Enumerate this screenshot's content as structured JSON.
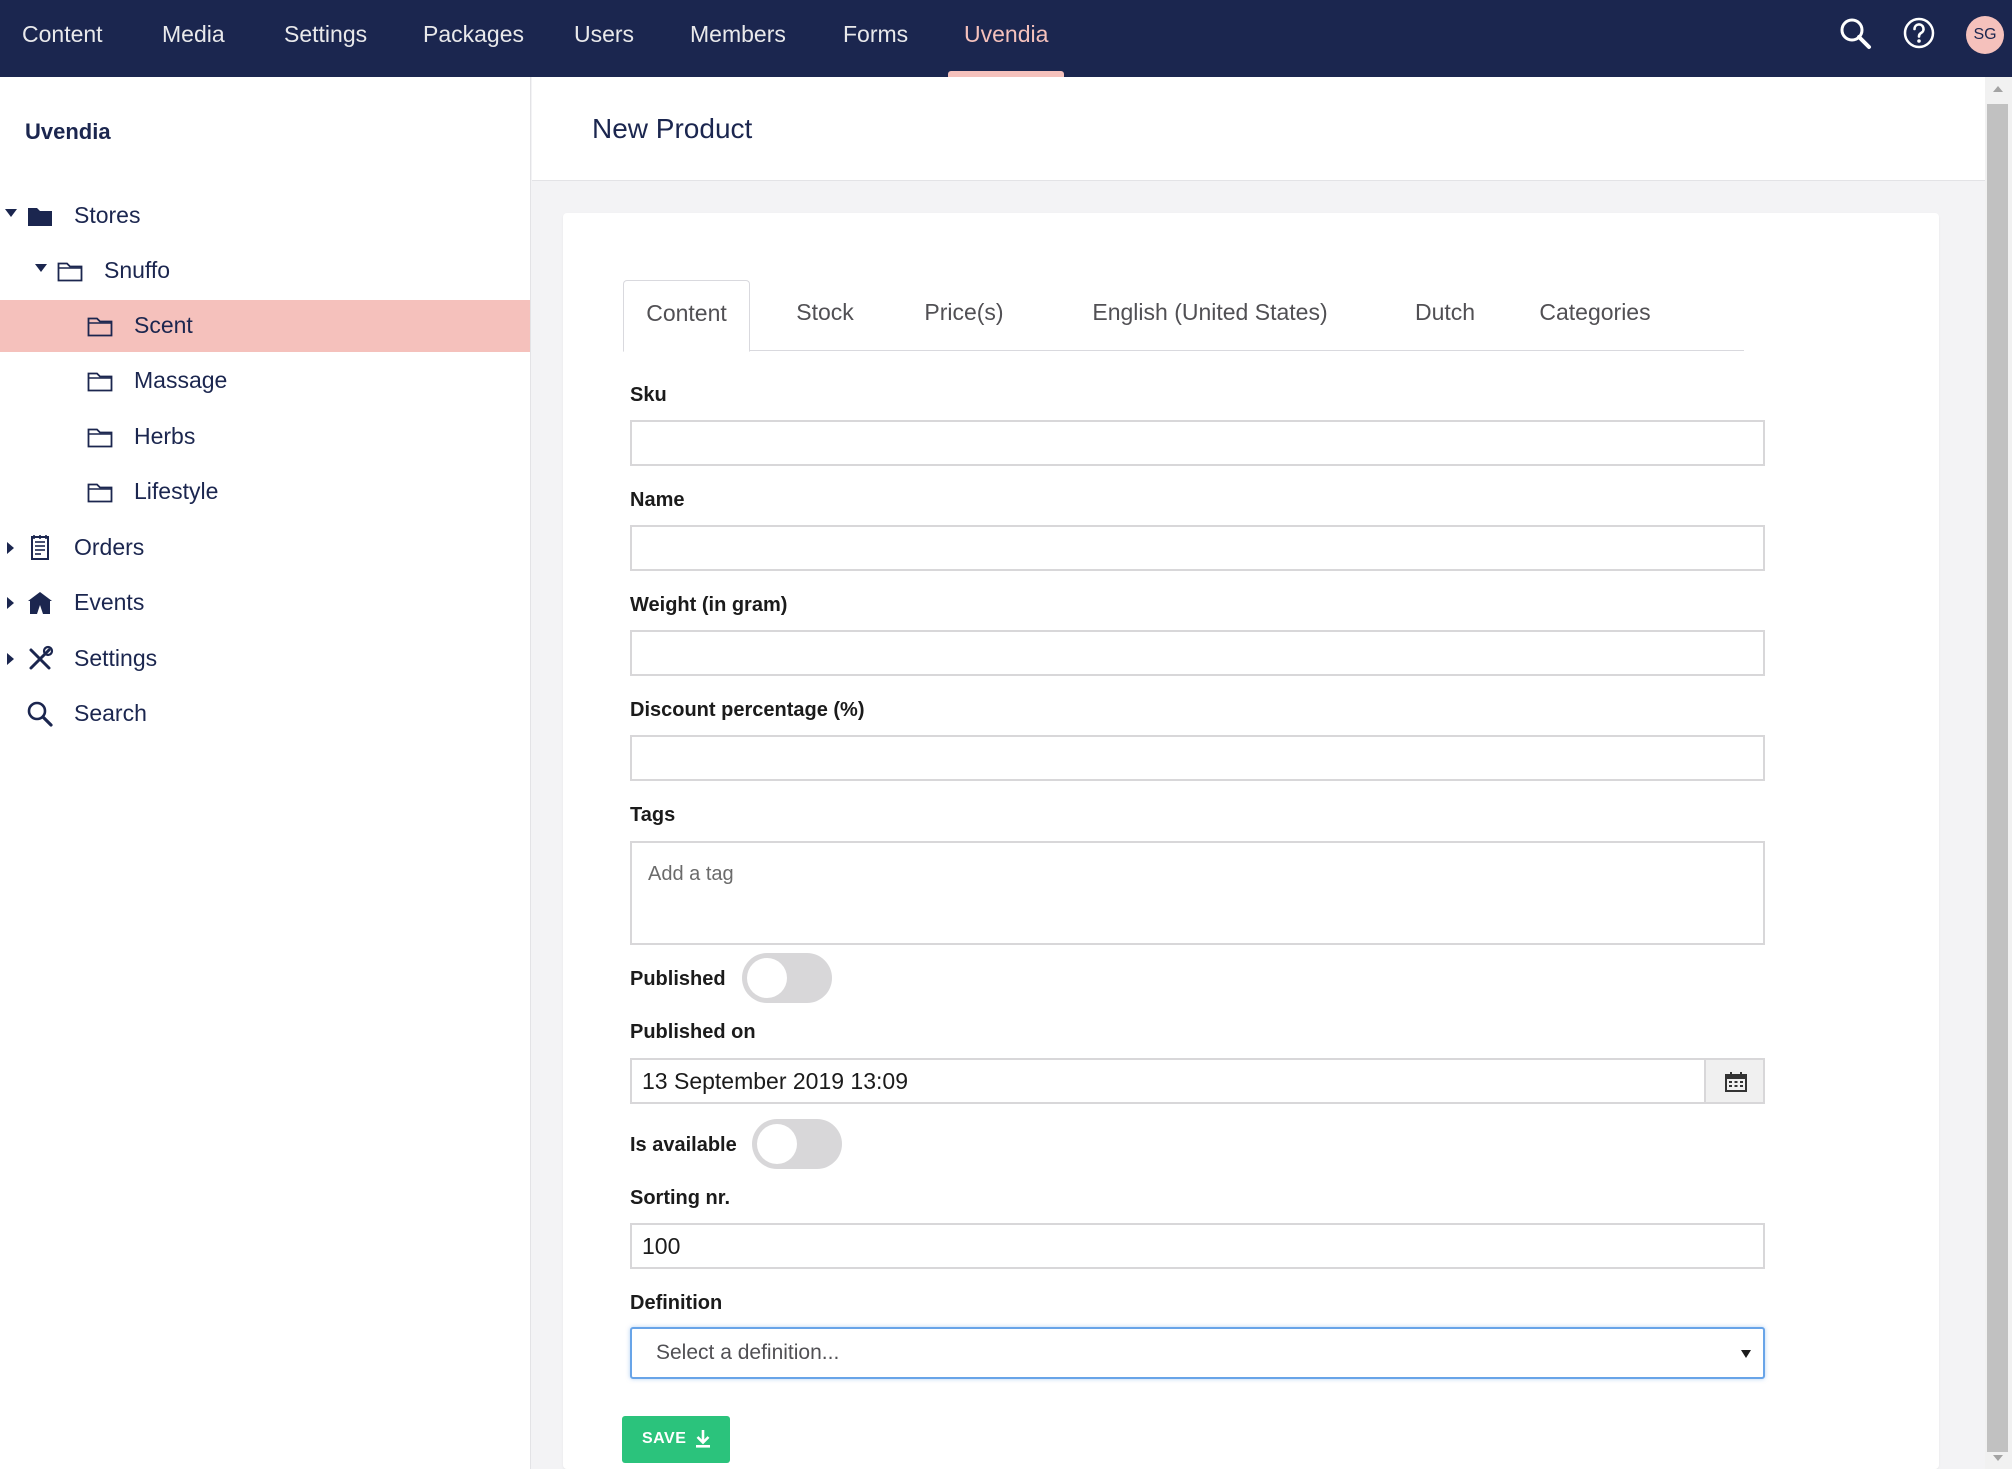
{
  "topnav": {
    "items": [
      {
        "label": "Content"
      },
      {
        "label": "Media"
      },
      {
        "label": "Settings"
      },
      {
        "label": "Packages"
      },
      {
        "label": "Users"
      },
      {
        "label": "Members"
      },
      {
        "label": "Forms"
      },
      {
        "label": "Uvendia",
        "active": true
      }
    ],
    "avatar_initials": "SG",
    "icons": [
      "search-icon",
      "help-icon"
    ]
  },
  "sidebar": {
    "title": "Uvendia",
    "tree": [
      {
        "label": "Stores",
        "icon": "folder-filled-icon",
        "expanded": true
      },
      {
        "label": "Snuffo",
        "icon": "folder-icon",
        "expanded": true
      },
      {
        "label": "Scent",
        "icon": "folder-icon",
        "selected": true
      },
      {
        "label": "Massage",
        "icon": "folder-icon"
      },
      {
        "label": "Herbs",
        "icon": "folder-icon"
      },
      {
        "label": "Lifestyle",
        "icon": "folder-icon"
      },
      {
        "label": "Orders",
        "icon": "receipt-icon",
        "expanded": false
      },
      {
        "label": "Events",
        "icon": "tent-icon",
        "expanded": false
      },
      {
        "label": "Settings",
        "icon": "tools-icon",
        "expanded": false
      },
      {
        "label": "Search",
        "icon": "search-icon"
      }
    ]
  },
  "main": {
    "page_title": "New Product",
    "tabs": [
      {
        "label": "Content",
        "active": true
      },
      {
        "label": "Stock"
      },
      {
        "label": "Price(s)"
      },
      {
        "label": "English (United States)"
      },
      {
        "label": "Dutch"
      },
      {
        "label": "Categories"
      }
    ],
    "form": {
      "sku_label": "Sku",
      "sku_value": "",
      "name_label": "Name",
      "name_value": "",
      "weight_label": "Weight (in gram)",
      "weight_value": "",
      "discount_label": "Discount percentage (%)",
      "discount_value": "",
      "tags_label": "Tags",
      "tags_placeholder": "Add a tag",
      "published_label": "Published",
      "published": false,
      "published_on_label": "Published on",
      "published_on_value": "13 September 2019 13:09",
      "is_available_label": "Is available",
      "is_available": false,
      "sorting_label": "Sorting nr.",
      "sorting_value": "100",
      "definition_label": "Definition",
      "definition_placeholder": "Select a definition..."
    },
    "save_label": "SAVE"
  },
  "colors": {
    "nav_bg": "#1b264f",
    "accent": "#f5c1bc",
    "save_green": "#2bc37c",
    "focus_blue": "#68a4e8"
  }
}
